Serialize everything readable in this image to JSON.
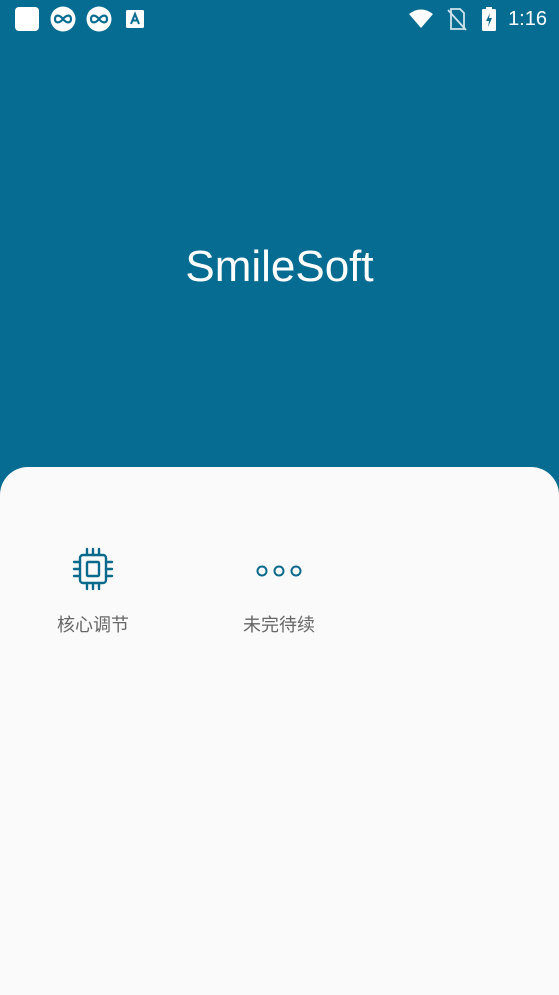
{
  "status_bar": {
    "time": "1:16",
    "icons_left": [
      "app-square-icon",
      "infinity-app-icon",
      "infinity-app-icon",
      "font-a-icon"
    ],
    "icons_right": [
      "wifi-icon",
      "no-sim-icon",
      "battery-charging-icon"
    ]
  },
  "header": {
    "title": "SmileSoft",
    "background_color": "#066c91"
  },
  "menu": {
    "items": [
      {
        "label": "核心调节",
        "icon": "cpu-chip-icon"
      },
      {
        "label": "未完待续",
        "icon": "more-dots-icon"
      }
    ]
  },
  "colors": {
    "accent": "#0b6a8c",
    "panel": "#fafafa",
    "label": "#666666"
  }
}
